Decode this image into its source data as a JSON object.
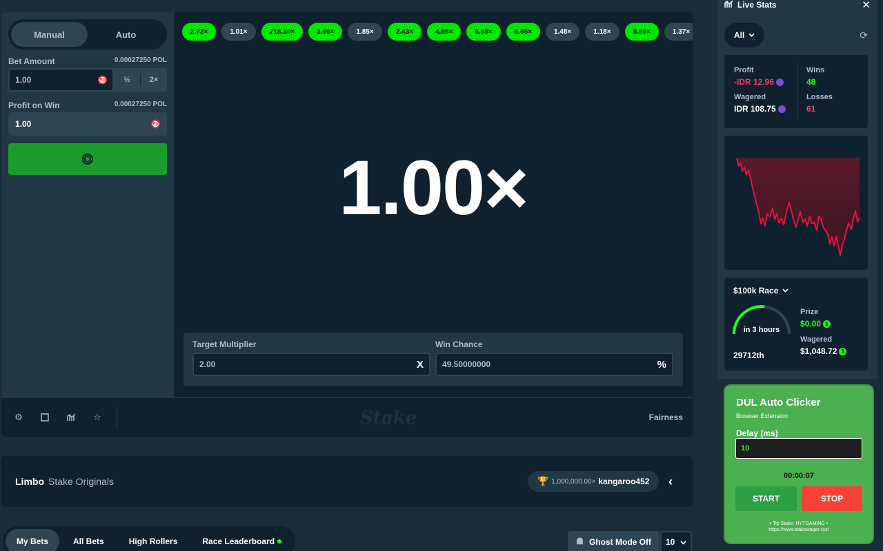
{
  "sidebar": {
    "mode_tabs": [
      "Manual",
      "Auto"
    ],
    "bet_amount": {
      "label": "Bet Amount",
      "sub": "0.00027250 POL",
      "value": "1.00",
      "currency": "Rp",
      "half": "½",
      "double": "2×"
    },
    "profit_on_win": {
      "label": "Profit on Win",
      "sub": "0.00027250 POL",
      "value": "1.00",
      "currency": "Rp"
    }
  },
  "history": [
    {
      "v": "2.72×",
      "win": true
    },
    {
      "v": "1.01×",
      "win": false
    },
    {
      "v": "718.30×",
      "win": true
    },
    {
      "v": "3.66×",
      "win": true
    },
    {
      "v": "1.85×",
      "win": false
    },
    {
      "v": "2.43×",
      "win": true
    },
    {
      "v": "4.85×",
      "win": true
    },
    {
      "v": "6.98×",
      "win": true
    },
    {
      "v": "6.65×",
      "win": true
    },
    {
      "v": "1.48×",
      "win": false
    },
    {
      "v": "1.18×",
      "win": false
    },
    {
      "v": "5.59×",
      "win": true
    },
    {
      "v": "1.37×",
      "win": false
    }
  ],
  "game": {
    "multiplier": "1.00×",
    "target_multiplier": {
      "label": "Target Multiplier",
      "value": "2.00",
      "suffix": "X"
    },
    "win_chance": {
      "label": "Win Chance",
      "value": "49.50000000",
      "suffix": "%"
    }
  },
  "footer": {
    "brand": "Stake",
    "fairness": "Fairness"
  },
  "infobar": {
    "title": "Limbo",
    "subtitle": "Stake Originals",
    "record": "1,000,000.00×",
    "record_user": "kangaroo452"
  },
  "bet_tabs": [
    "My Bets",
    "All Bets",
    "High Rollers",
    "Race Leaderboard"
  ],
  "ghost_mode": "Ghost Mode Off",
  "bet_count": "10",
  "live_stats": {
    "title": "Live Stats",
    "filter": "All",
    "profit_label": "Profit",
    "profit_value": "-IDR 12.96",
    "wagered_label": "Wagered",
    "wagered_value": "IDR 108.75",
    "wins_label": "Wins",
    "wins_value": "48",
    "losses_label": "Losses",
    "losses_value": "61",
    "race": {
      "title": "$100k Race",
      "time_left": "in 3 hours",
      "progress": 0.55,
      "rank": "29712th",
      "prize_label": "Prize",
      "prize_value": "$0.00",
      "wagered_label": "Wagered",
      "wagered_value": "$1,048.72"
    }
  },
  "auto_clicker": {
    "title": "DUL Auto Clicker",
    "subtitle": "Browser Extension",
    "delay_label": "Delay (ms)",
    "delay_value": "10",
    "timer": "00:00:07",
    "start": "START",
    "stop": "STOP",
    "tip_line1": "• Tip Stake: HYTGAMING •",
    "tip_line2": "https://www.stakewager.xyz/"
  },
  "colors": {
    "win": "#00e701",
    "lose": "#2f4553",
    "bet_button": "#1a9c2c",
    "profit_negative": "#ed4163",
    "chart_line": "#e9113c",
    "clicker_bg": "#4caf50"
  }
}
